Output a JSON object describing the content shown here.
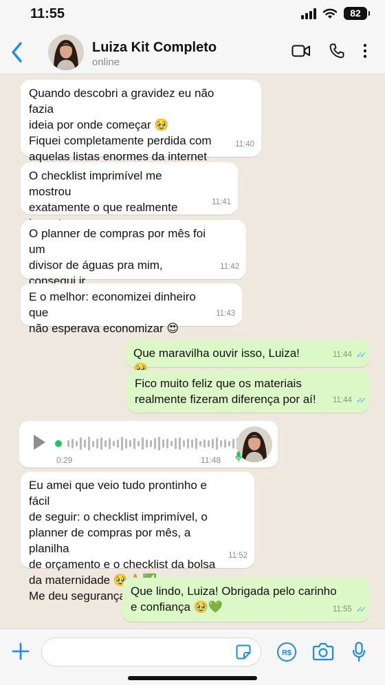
{
  "status_bar": {
    "time": "11:55",
    "battery": "82"
  },
  "header": {
    "name": "Luiza Kit Completo",
    "status": "online"
  },
  "messages": [
    {
      "text": "Quando descobri a gravidez eu não fazia\nideia por onde começar 🥹\nFiquei completamente perdida com\naquelas listas enormes da internet",
      "time": "11:40"
    },
    {
      "text": "O checklist imprimível me mostrou\nexatamente o que realmente importava",
      "time": "11:41"
    },
    {
      "text": "O planner de compras por mês foi um\ndivisor de águas pra mim, consegui ir\npasso a passo sem desespero",
      "time": "11:42"
    },
    {
      "text": "E o melhor: economizei dinheiro que\nnão esperava economizar 😍",
      "time": "11:43"
    },
    {
      "text": "Que maravilha ouvir isso, Luiza! 🥹",
      "time": "11:44"
    },
    {
      "text": "Fico muito feliz que os materiais\nrealmente fizeram diferença por aí!",
      "time": "11:44"
    },
    {
      "text": "Eu amei que veio tudo prontinho e fácil\nde seguir: o checklist imprimível, o\nplanner de compras por mês, a planilha\nde orçamento e o checklist da bolsa\nda maternidade 🥹🙏✅\nMe deu segurança e tranquilidade",
      "time": "11:52"
    },
    {
      "text": "Que lindo, Luiza! Obrigada pelo carinho\ne confiança 🥹💚",
      "time": "11:55"
    }
  ],
  "voice_note": {
    "duration": "0:29",
    "time": "11:48"
  },
  "input": {
    "placeholder": ""
  },
  "colors": {
    "accent": "#1a8af5",
    "outgoing_bubble": "#dcf8c6",
    "incoming_bubble": "#ffffff",
    "read_ticks": "#4fb6ec",
    "chat_bg": "#efe8df"
  },
  "icons": [
    "back-chevron",
    "video-camera",
    "phone",
    "more-vertical",
    "play",
    "microphone",
    "plus",
    "sticker",
    "pix-payment",
    "camera"
  ]
}
